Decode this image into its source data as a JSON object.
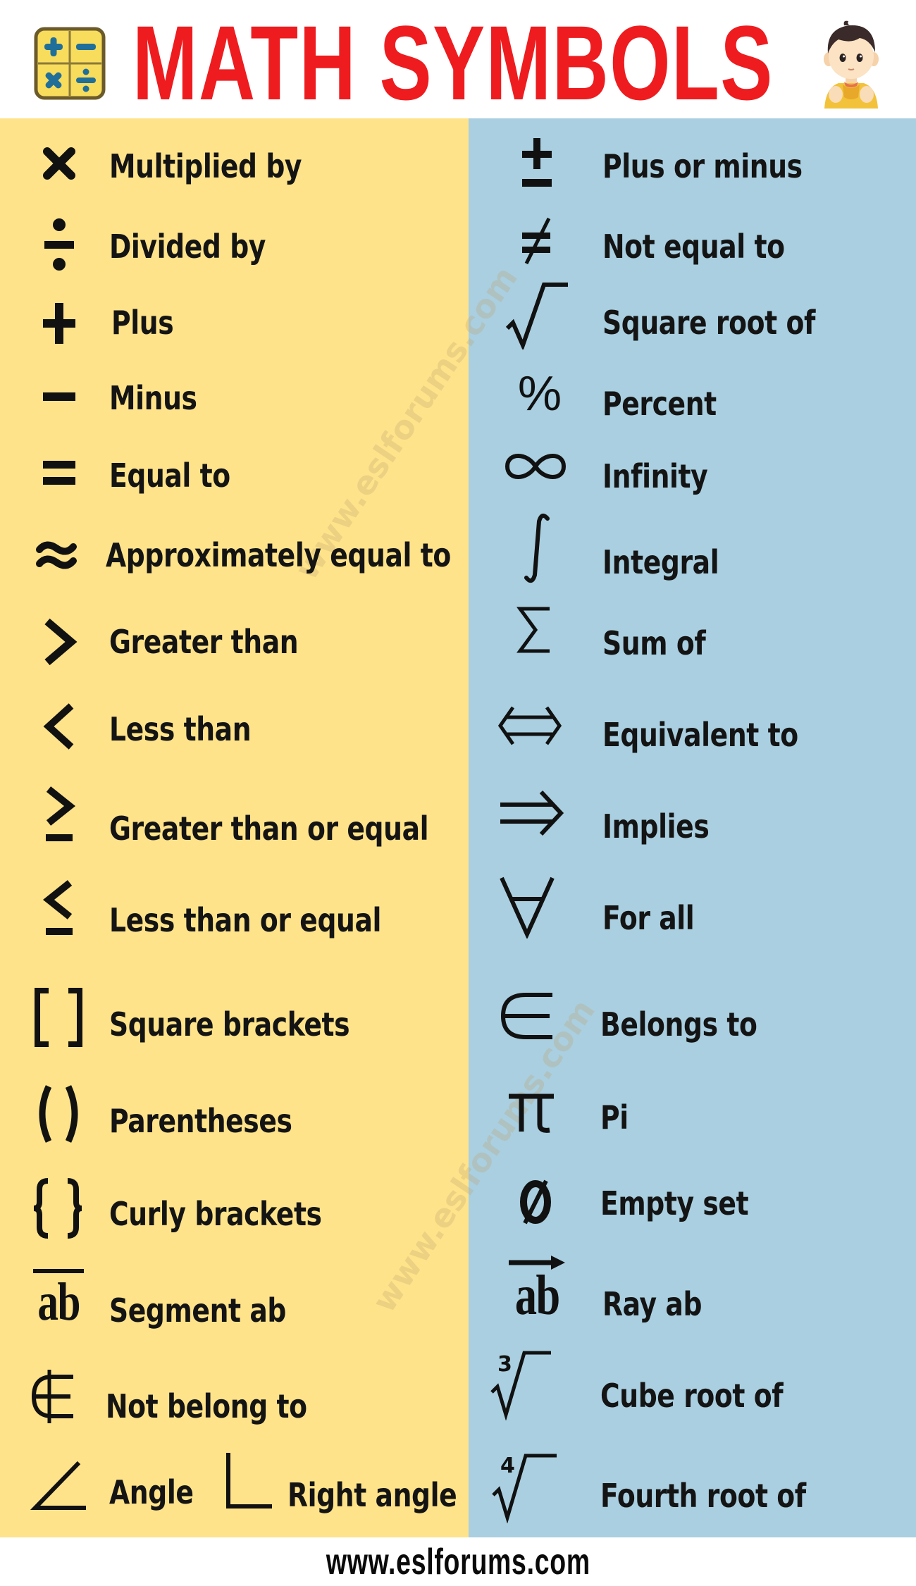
{
  "header": {
    "title": "MATH SYMBOLS",
    "title_color": "#ee1c1f",
    "logo_icon": "calculator-operations-icon",
    "mascot": "boy-mascot-illustration"
  },
  "colors": {
    "left_column": "#fee38a",
    "right_column": "#a9cfe0",
    "icon_blue": "#1f6f9a"
  },
  "left_symbols": [
    {
      "symbol": "×",
      "label": "Multiplied by",
      "icon": "multiply-icon"
    },
    {
      "symbol": "÷",
      "label": "Divided by",
      "icon": "divide-icon"
    },
    {
      "symbol": "+",
      "label": "Plus",
      "icon": "plus-icon"
    },
    {
      "symbol": "−",
      "label": "Minus",
      "icon": "minus-icon"
    },
    {
      "symbol": "=",
      "label": "Equal to",
      "icon": "equals-icon"
    },
    {
      "symbol": "≈",
      "label": "Approximately equal to",
      "icon": "approx-icon"
    },
    {
      "symbol": ">",
      "label": "Greater than",
      "icon": "greater-than-icon"
    },
    {
      "symbol": "<",
      "label": "Less than",
      "icon": "less-than-icon"
    },
    {
      "symbol": "≥",
      "label": "Greater than or equal",
      "icon": "greater-equal-icon"
    },
    {
      "symbol": "≤",
      "label": "Less than or equal",
      "icon": "less-equal-icon"
    },
    {
      "symbol": "[ ]",
      "label": "Square brackets",
      "icon": "square-brackets-icon"
    },
    {
      "symbol": "( )",
      "label": "Parentheses",
      "icon": "parentheses-icon"
    },
    {
      "symbol": "{ }",
      "label": "Curly brackets",
      "icon": "curly-brackets-icon"
    },
    {
      "symbol": "ab",
      "label": "Segment ab",
      "icon": "segment-icon"
    },
    {
      "symbol": "∉",
      "label": "Not belong to",
      "icon": "not-element-icon"
    },
    {
      "symbol": "∠",
      "label": "Angle",
      "icon": "angle-icon",
      "extra_symbol": "∟",
      "extra_label": "Right angle",
      "extra_icon": "right-angle-icon"
    }
  ],
  "right_symbols": [
    {
      "symbol": "±",
      "label": "Plus or minus",
      "icon": "plus-minus-icon"
    },
    {
      "symbol": "≠",
      "label": "Not equal to",
      "icon": "not-equal-icon"
    },
    {
      "symbol": "√",
      "label": "Square root of",
      "icon": "square-root-icon"
    },
    {
      "symbol": "%",
      "label": "Percent",
      "icon": "percent-icon"
    },
    {
      "symbol": "∞",
      "label": "Infinity",
      "icon": "infinity-icon"
    },
    {
      "symbol": "∫",
      "label": "Integral",
      "icon": "integral-icon"
    },
    {
      "symbol": "Σ",
      "label": "Sum of",
      "icon": "sigma-icon"
    },
    {
      "symbol": "⇔",
      "label": "Equivalent to",
      "icon": "equivalent-arrow-icon"
    },
    {
      "symbol": "⇒",
      "label": "Implies",
      "icon": "implies-arrow-icon"
    },
    {
      "symbol": "∀",
      "label": "For all",
      "icon": "for-all-icon"
    },
    {
      "symbol": "∈",
      "label": "Belongs to",
      "icon": "element-of-icon"
    },
    {
      "symbol": "π",
      "label": "Pi",
      "icon": "pi-icon"
    },
    {
      "symbol": "Ø",
      "label": "Empty set",
      "icon": "empty-set-icon"
    },
    {
      "symbol": "ab",
      "label": "Ray ab",
      "icon": "ray-icon"
    },
    {
      "symbol": "∛",
      "label": "Cube root of",
      "icon": "cube-root-icon",
      "index": "3"
    },
    {
      "symbol": "∜",
      "label": "Fourth root of",
      "icon": "fourth-root-icon",
      "index": "4"
    }
  ],
  "watermark": "www.eslforums.com",
  "footer": {
    "url": "www.eslforums.com"
  }
}
